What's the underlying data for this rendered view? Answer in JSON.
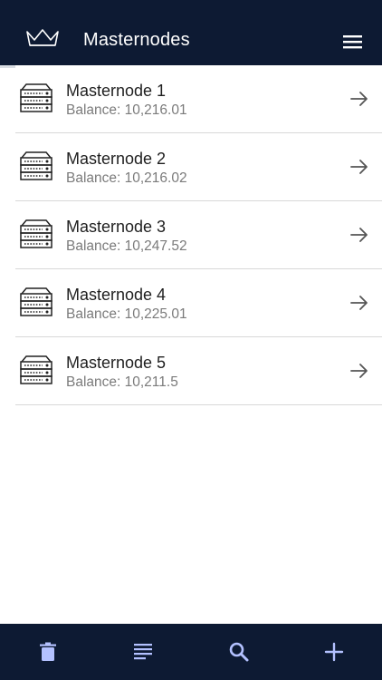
{
  "header": {
    "title": "Masternodes",
    "logo_icon": "crown-logo-icon",
    "menu_icon": "hamburger-menu-icon"
  },
  "colors": {
    "header_bg": "#0d1a33",
    "toolbar_bg": "#0d1a33",
    "toolbar_icon": "#b3c1ff",
    "text_primary": "#1f1f1f",
    "text_secondary": "#7b7b7b",
    "divider": "#d8d8d8"
  },
  "masternodes": [
    {
      "name": "Masternode 1",
      "balance": "Balance: 10,216.01"
    },
    {
      "name": "Masternode 2",
      "balance": "Balance: 10,216.02"
    },
    {
      "name": "Masternode 3",
      "balance": "Balance: 10,247.52"
    },
    {
      "name": "Masternode 4",
      "balance": "Balance: 10,225.01"
    },
    {
      "name": "Masternode 5",
      "balance": "Balance: 10,211.5"
    }
  ],
  "toolbar": {
    "items": [
      {
        "icon": "trash-icon"
      },
      {
        "icon": "list-icon"
      },
      {
        "icon": "search-icon"
      },
      {
        "icon": "plus-icon"
      }
    ]
  }
}
